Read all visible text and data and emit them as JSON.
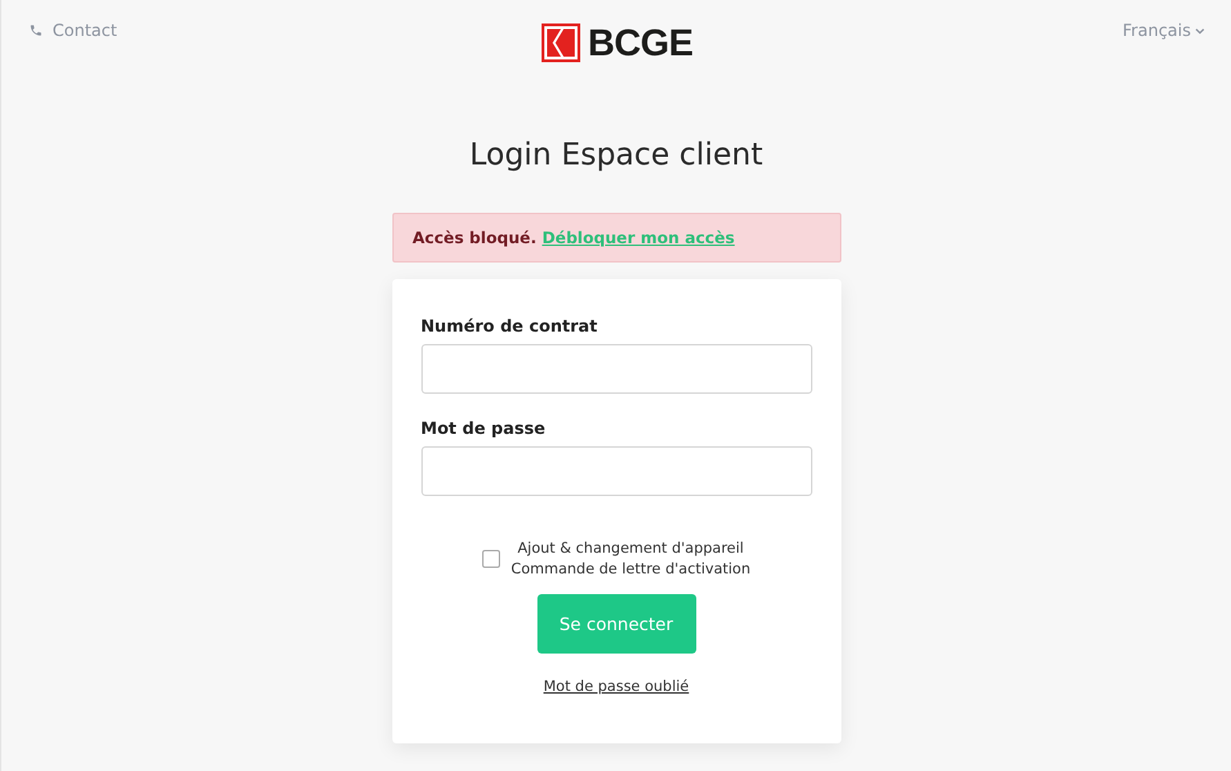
{
  "header": {
    "contact": "Contact",
    "logo": "BCGE",
    "language": "Français"
  },
  "title": "Login Espace client",
  "alert": {
    "text": "Accès bloqué.",
    "link": "Débloquer mon accès"
  },
  "form": {
    "fields": [
      {
        "label": "Numéro de contrat"
      },
      {
        "label": "Mot de passe"
      }
    ],
    "checkbox": {
      "checked": false,
      "lines": [
        "Ajout & changement d'appareil",
        "Commande de lettre d'activation"
      ]
    },
    "submit": "Se connecter",
    "forgot": "Mot de passe oublié"
  }
}
